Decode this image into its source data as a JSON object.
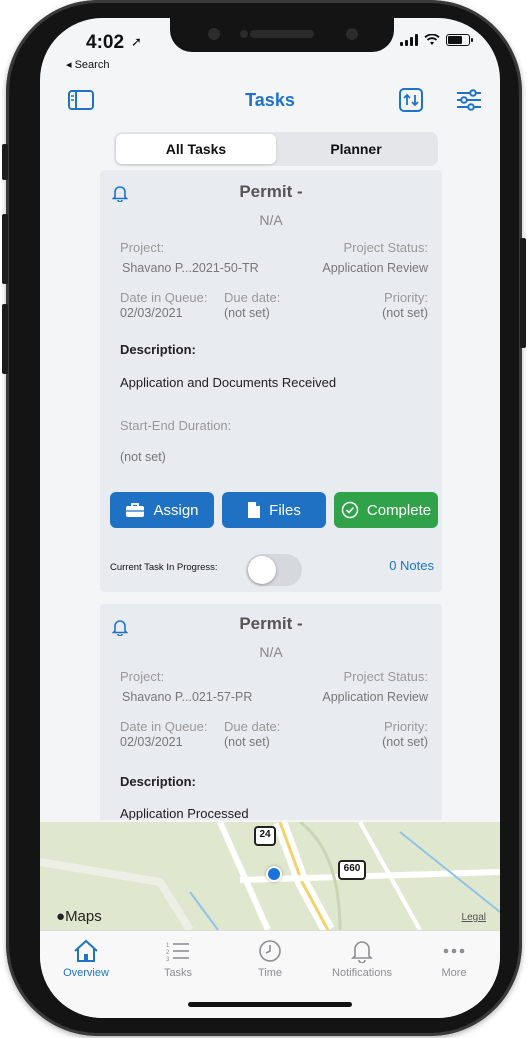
{
  "status_bar": {
    "time": "4:02",
    "back_label": "◂ Search"
  },
  "nav": {
    "title": "Tasks"
  },
  "segment": {
    "options": [
      "All Tasks",
      "Planner"
    ],
    "selected": "All Tasks"
  },
  "cards": [
    {
      "title": "Permit -",
      "subtitle": "N/A",
      "project_label": "Project:",
      "project_value": "Shavano P...2021-50-TR",
      "status_label": "Project Status:",
      "status_value": "Application Review",
      "queue_label": "Date in Queue:",
      "queue_value": "02/03/2021",
      "due_label": "Due date:",
      "due_value": "(not set)",
      "priority_label": "Priority:",
      "priority_value": "(not set)",
      "description_label": "Description:",
      "description": "Application and Documents Received",
      "duration_label": "Start-End Duration:",
      "duration_value": "(not set)",
      "assign_label": "Assign",
      "files_label": "Files",
      "complete_label": "Complete",
      "in_progress_label": "Current Task In Progress:",
      "notes_label": "0 Notes"
    },
    {
      "title": "Permit -",
      "subtitle": "N/A",
      "project_label": "Project:",
      "project_value": "Shavano P...021-57-PR",
      "status_label": "Project Status:",
      "status_value": "Application Review",
      "queue_label": "Date in Queue:",
      "queue_value": "02/03/2021",
      "due_label": "Due date:",
      "due_value": "(not set)",
      "priority_label": "Priority:",
      "priority_value": "(not set)",
      "description_label": "Description:",
      "description": "Application Processed"
    }
  ],
  "map": {
    "brand": "Maps",
    "legal": "Legal",
    "shields": [
      "24",
      "660"
    ]
  },
  "tabs": [
    {
      "label": "Overview",
      "icon": "home-icon"
    },
    {
      "label": "Tasks",
      "icon": "list-icon"
    },
    {
      "label": "Time",
      "icon": "clock-icon"
    },
    {
      "label": "Notifications",
      "icon": "bell-icon"
    },
    {
      "label": "More",
      "icon": "more-dots-icon"
    }
  ],
  "active_tab": "Overview",
  "colors": {
    "accent": "#1e73c8",
    "assign": "#1f72c3",
    "complete": "#2fa24a"
  }
}
